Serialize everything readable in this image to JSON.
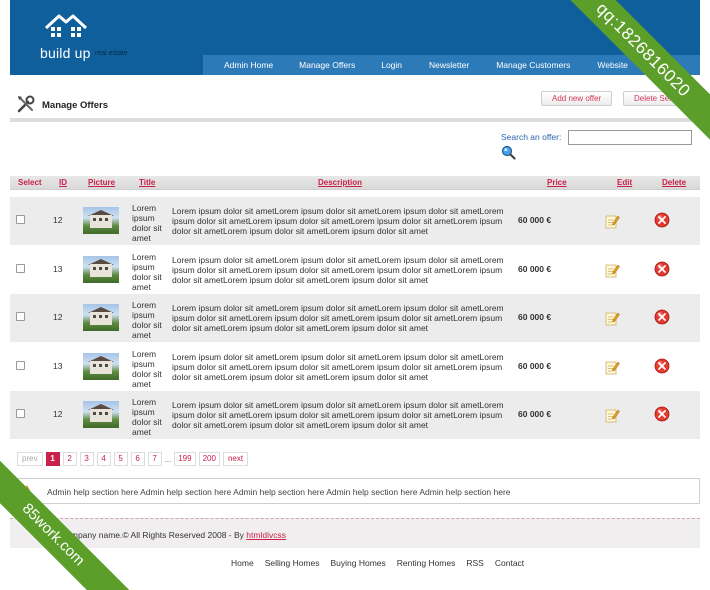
{
  "brand": {
    "name": "build up",
    "tagline": "real estate"
  },
  "nav": [
    "Admin Home",
    "Manage Offers",
    "Login",
    "Newsletter",
    "Manage Customers",
    "Website"
  ],
  "watermarks": {
    "top_right": "qq:1826816020",
    "bottom_left": "85work.com"
  },
  "page": {
    "title": "Manage Offers",
    "add_button": "Add new offer",
    "delete_button": "Delete Selected"
  },
  "search": {
    "label": "Search an offer:",
    "value": ""
  },
  "table": {
    "headers": {
      "select": "Select",
      "id": "ID",
      "picture": "Picture",
      "title": "Title",
      "description": "Description",
      "price": "Price",
      "edit": "Edit",
      "delete": "Delete"
    },
    "rows": [
      {
        "id": "12",
        "title": "Lorem ipsum dolor sit amet",
        "description": "Lorem ipsum dolor sit ametLorem ipsum dolor sit ametLorem ipsum dolor sit ametLorem ipsum dolor sit ametLorem ipsum dolor sit ametLorem ipsum dolor sit ametLorem ipsum dolor sit ametLorem ipsum dolor sit ametLorem ipsum dolor sit amet",
        "price": "60 000 €"
      },
      {
        "id": "13",
        "title": "Lorem ipsum dolor sit amet",
        "description": "Lorem ipsum dolor sit ametLorem ipsum dolor sit ametLorem ipsum dolor sit ametLorem ipsum dolor sit ametLorem ipsum dolor sit ametLorem ipsum dolor sit ametLorem ipsum dolor sit ametLorem ipsum dolor sit ametLorem ipsum dolor sit amet",
        "price": "60 000 €"
      },
      {
        "id": "12",
        "title": "Lorem ipsum dolor sit amet",
        "description": "Lorem ipsum dolor sit ametLorem ipsum dolor sit ametLorem ipsum dolor sit ametLorem ipsum dolor sit ametLorem ipsum dolor sit ametLorem ipsum dolor sit ametLorem ipsum dolor sit ametLorem ipsum dolor sit ametLorem ipsum dolor sit amet",
        "price": "60 000 €"
      },
      {
        "id": "13",
        "title": "Lorem ipsum dolor sit amet",
        "description": "Lorem ipsum dolor sit ametLorem ipsum dolor sit ametLorem ipsum dolor sit ametLorem ipsum dolor sit ametLorem ipsum dolor sit ametLorem ipsum dolor sit ametLorem ipsum dolor sit ametLorem ipsum dolor sit ametLorem ipsum dolor sit amet",
        "price": "60 000 €"
      },
      {
        "id": "12",
        "title": "Lorem ipsum dolor sit amet",
        "description": "Lorem ipsum dolor sit ametLorem ipsum dolor sit ametLorem ipsum dolor sit ametLorem ipsum dolor sit ametLorem ipsum dolor sit ametLorem ipsum dolor sit ametLorem ipsum dolor sit ametLorem ipsum dolor sit ametLorem ipsum dolor sit amet",
        "price": "60 000 €"
      }
    ]
  },
  "pagination": {
    "prev": "prev",
    "pages": [
      "1",
      "2",
      "3",
      "4",
      "5",
      "6",
      "7"
    ],
    "dots": "...",
    "tail": [
      "199",
      "200"
    ],
    "next": "next",
    "current": "1"
  },
  "help": {
    "text": "Admin help section here Admin help section here Admin help section here Admin help section here Admin help section here"
  },
  "footer": {
    "copyright": "Company name.© All Rights Reserved 2008 - By",
    "credit": "htmldivcss",
    "links": [
      "Home",
      "Selling Homes",
      "Buying Homes",
      "Renting Homes",
      "RSS",
      "Contact"
    ]
  },
  "colors": {
    "header": "#0f5f9c",
    "nav": "#2d7ab8",
    "accent": "#c8214a",
    "ribbon": "#5c9e2a"
  }
}
